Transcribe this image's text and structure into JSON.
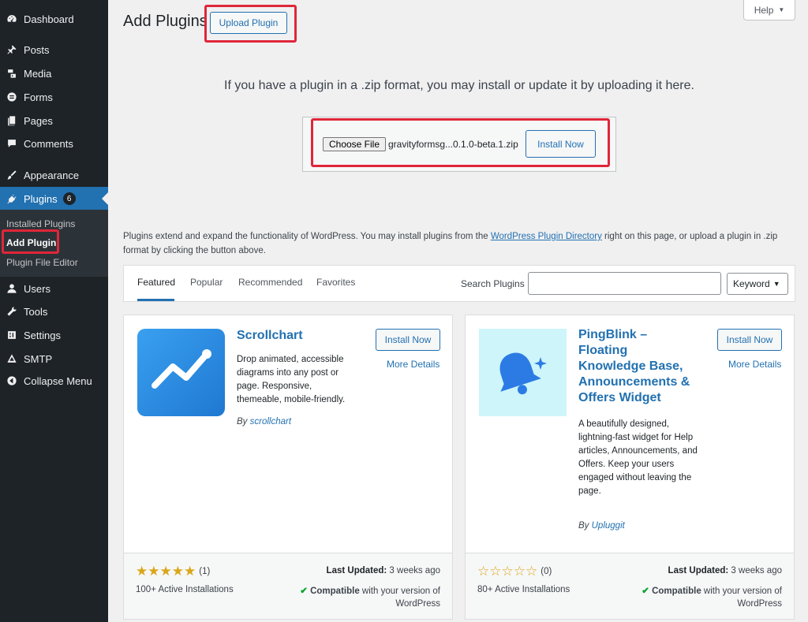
{
  "sidebar": {
    "items": [
      {
        "label": "Dashboard",
        "icon": "dashboard-icon"
      },
      {
        "label": "Posts",
        "icon": "pin-icon"
      },
      {
        "label": "Media",
        "icon": "media-icon"
      },
      {
        "label": "Forms",
        "icon": "forms-icon"
      },
      {
        "label": "Pages",
        "icon": "pages-icon"
      },
      {
        "label": "Comments",
        "icon": "comments-icon"
      },
      {
        "label": "Appearance",
        "icon": "brush-icon"
      },
      {
        "label": "Plugins",
        "icon": "plug-icon",
        "badge": "6"
      },
      {
        "label": "Users",
        "icon": "users-icon"
      },
      {
        "label": "Tools",
        "icon": "wrench-icon"
      },
      {
        "label": "Settings",
        "icon": "settings-icon"
      },
      {
        "label": "SMTP",
        "icon": "smtp-icon"
      },
      {
        "label": "Collapse Menu",
        "icon": "collapse-icon"
      }
    ],
    "submenu": [
      "Installed Plugins",
      "Add Plugin",
      "Plugin File Editor"
    ]
  },
  "header": {
    "title": "Add Plugins",
    "upload_button": "Upload Plugin",
    "help": "Help"
  },
  "upload": {
    "intro": "If you have a plugin in a .zip format, you may install or update it by uploading it here.",
    "choose_file": "Choose File",
    "file_name": "gravityformsg...0.1.0-beta.1.zip",
    "install_button": "Install Now"
  },
  "description": {
    "before": "Plugins extend and expand the functionality of WordPress. You may install plugins from the ",
    "link": "WordPress Plugin Directory",
    "after": " right on this page, or upload a plugin in .zip format by clicking the button above."
  },
  "filter": {
    "tabs": [
      "Featured",
      "Popular",
      "Recommended",
      "Favorites"
    ],
    "search_label": "Search Plugins",
    "search_value": "",
    "select_value": "Keyword"
  },
  "cards": [
    {
      "name": "Scrollchart",
      "description": "Drop animated, accessible diagrams into any post or page. Responsive, themeable, mobile-friendly.",
      "by": "By",
      "author": "scrollchart",
      "install": "Install Now",
      "more": "More Details",
      "rating": 5,
      "rating_count": "(1)",
      "installs": "100+ Active Installations",
      "last_updated_label": "Last Updated:",
      "last_updated": "3 weeks ago",
      "compatible": "Compatible",
      "compat_rest": "with your version of WordPress",
      "icon_color": "#2b8be0"
    },
    {
      "name": "PingBlink – Floating Knowledge Base, Announcements & Offers Widget",
      "description": "A beautifully designed, lightning-fast widget for Help articles, Announcements, and Offers. Keep your users engaged without leaving the page.",
      "by": "By",
      "author": "Upluggit",
      "install": "Install Now",
      "more": "More Details",
      "rating": 0,
      "rating_count": "(0)",
      "installs": "80+ Active Installations",
      "last_updated_label": "Last Updated:",
      "last_updated": "3 weeks ago",
      "compatible": "Compatible",
      "compat_rest": "with your version of WordPress",
      "icon_color": "#cdf5fa"
    }
  ],
  "colors": {
    "accent": "#2271b1",
    "highlight": "#e0263a",
    "sidebar": "#1d2327"
  }
}
